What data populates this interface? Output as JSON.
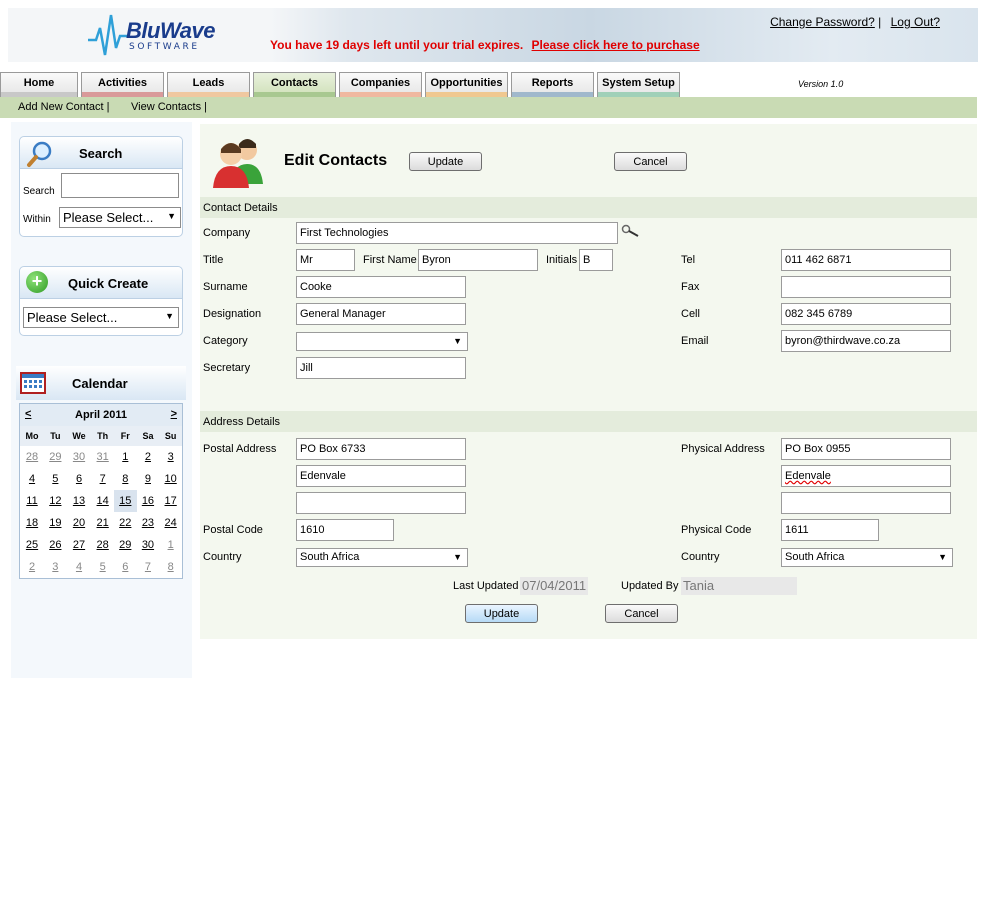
{
  "header": {
    "logo_text": "BluWave",
    "logo_sub": "SOFTWARE",
    "change_password": "Change Password?",
    "separator": "|",
    "logout": "Log Out?",
    "trial_message": "You have 19 days left until your trial expires.",
    "purchase_link": "Please click here to purchase"
  },
  "tabs": [
    {
      "label": "Home",
      "color": "#c8c8c8"
    },
    {
      "label": "Activities",
      "color": "#d99a9a"
    },
    {
      "label": "Leads",
      "color": "#f0c8a0"
    },
    {
      "label": "Contacts",
      "color": "#a8c890"
    },
    {
      "label": "Companies",
      "color": "#f0b8a0"
    },
    {
      "label": "Opportunities",
      "color": "#f0c890"
    },
    {
      "label": "Reports",
      "color": "#a0b8cc"
    },
    {
      "label": "System Setup",
      "color": "#a0d0b8"
    }
  ],
  "version": "Version 1.0",
  "subnav": {
    "add_new": "Add New Contact |",
    "view": "View Contacts |"
  },
  "search_panel": {
    "title": "Search",
    "search_label": "Search",
    "within_label": "Within",
    "within_value": "Please Select..."
  },
  "quick_create": {
    "title": "Quick Create",
    "value": "Please Select..."
  },
  "calendar": {
    "title": "Calendar",
    "prev": "<",
    "next": ">",
    "month": "April 2011",
    "weekdays": [
      "Mo",
      "Tu",
      "We",
      "Th",
      "Fr",
      "Sa",
      "Su"
    ],
    "weeks": [
      [
        "28",
        "29",
        "30",
        "31",
        "1",
        "2",
        "3"
      ],
      [
        "4",
        "5",
        "6",
        "7",
        "8",
        "9",
        "10"
      ],
      [
        "11",
        "12",
        "13",
        "14",
        "15",
        "16",
        "17"
      ],
      [
        "18",
        "19",
        "20",
        "21",
        "22",
        "23",
        "24"
      ],
      [
        "25",
        "26",
        "27",
        "28",
        "29",
        "30",
        "1"
      ],
      [
        "2",
        "3",
        "4",
        "5",
        "6",
        "7",
        "8"
      ]
    ]
  },
  "page": {
    "title": "Edit Contacts",
    "update": "Update",
    "cancel": "Cancel"
  },
  "contact_details": {
    "heading": "Contact Details",
    "company_label": "Company",
    "company": "First Technologies",
    "title_label": "Title",
    "title": "Mr",
    "first_name_label": "First Name",
    "first_name": "Byron",
    "initials_label": "Initials",
    "initials": "B",
    "surname_label": "Surname",
    "surname": "Cooke",
    "designation_label": "Designation",
    "designation": "General Manager",
    "category_label": "Category",
    "category": "",
    "secretary_label": "Secretary",
    "secretary": "Jill",
    "tel_label": "Tel",
    "tel": "011 462 6871",
    "fax_label": "Fax",
    "fax": "",
    "cell_label": "Cell",
    "cell": "082 345 6789",
    "email_label": "Email",
    "email": "byron@thirdwave.co.za"
  },
  "address_details": {
    "heading": "Address Details",
    "postal_label": "Postal Address",
    "postal_1": "PO Box 6733",
    "postal_2": "Edenvale",
    "postal_3": "",
    "postal_code_label": "Postal Code",
    "postal_code": "1610",
    "country_label": "Country",
    "country": "South Africa",
    "physical_label": "Physical Address",
    "physical_1": "PO Box 0955",
    "physical_2": "Edenvale",
    "physical_3": "",
    "physical_code_label": "Physical Code",
    "physical_code": "1611",
    "physical_country_label": "Country",
    "physical_country": "South Africa"
  },
  "footer": {
    "last_updated_label": "Last Updated",
    "last_updated": "07/04/2011",
    "updated_by_label": "Updated By",
    "updated_by": "Tania"
  }
}
